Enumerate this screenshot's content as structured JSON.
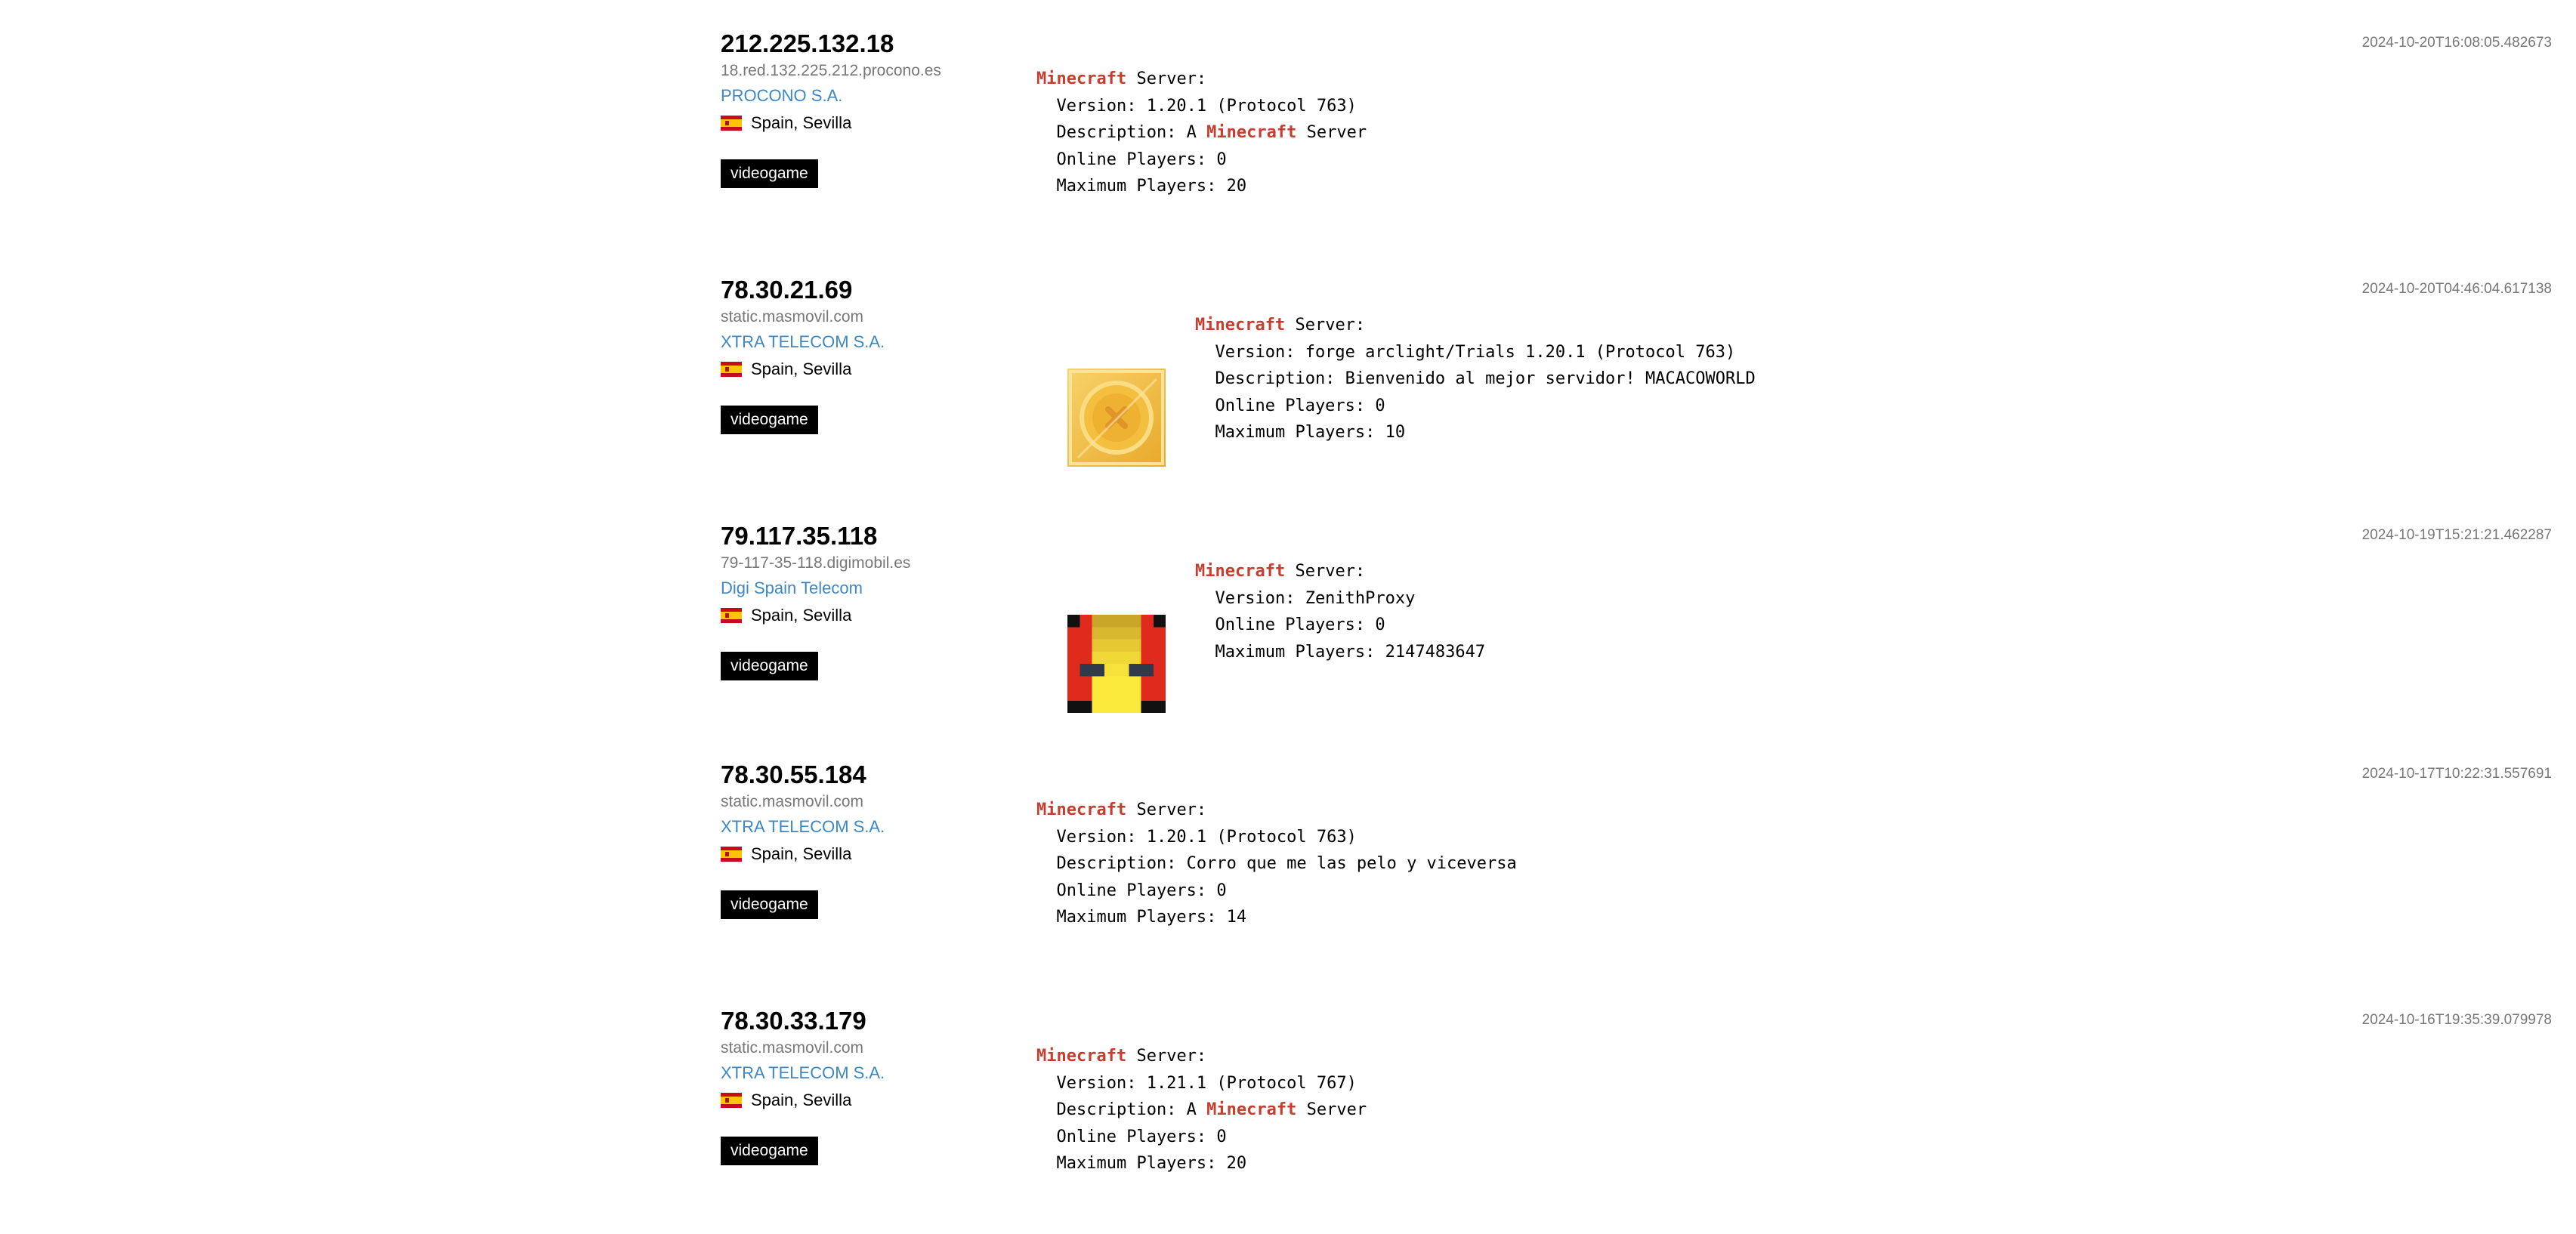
{
  "results": [
    {
      "ip": "212.225.132.18",
      "hostname": "18.red.132.225.212.procono.es",
      "org": "PROCONO S.A.",
      "location": "Spain, Sevilla",
      "tag": "videogame",
      "timestamp": "2024-10-20T16:08:05.482673",
      "banner": {
        "product": "Minecraft",
        "server_suffix": " Server:",
        "version_line": "  Version: 1.20.1 (Protocol 763)",
        "desc_prefix": "  Description: A ",
        "desc_highlight": "Minecraft",
        "desc_suffix": " Server",
        "online_line": "  Online Players: 0",
        "max_line": "  Maximum Players: 20"
      }
    },
    {
      "ip": "78.30.21.69",
      "hostname": "static.masmovil.com",
      "org": "XTRA TELECOM S.A.",
      "location": "Spain, Sevilla",
      "tag": "videogame",
      "timestamp": "2024-10-20T04:46:04.617138",
      "favicon_icon": "gold-coin-icon",
      "banner": {
        "product": "Minecraft",
        "server_suffix": " Server:",
        "version_line": "  Version: forge arclight/Trials 1.20.1 (Protocol 763)",
        "desc_line": "  Description: Bienvenido al mejor servidor! MACACOWORLD",
        "online_line": "  Online Players: 0",
        "max_line": "  Maximum Players: 10"
      }
    },
    {
      "ip": "79.117.35.118",
      "hostname": "79-117-35-118.digimobil.es",
      "org": "Digi Spain Telecom",
      "location": "Spain, Sevilla",
      "tag": "videogame",
      "timestamp": "2024-10-19T15:21:21.462287",
      "favicon_icon": "pixel-face-icon",
      "banner": {
        "product": "Minecraft",
        "server_suffix": " Server:",
        "version_line": "  Version: ZenithProxy",
        "online_line": "  Online Players: 0",
        "max_line": "  Maximum Players: 2147483647"
      }
    },
    {
      "ip": "78.30.55.184",
      "hostname": "static.masmovil.com",
      "org": "XTRA TELECOM S.A.",
      "location": "Spain, Sevilla",
      "tag": "videogame",
      "timestamp": "2024-10-17T10:22:31.557691",
      "banner": {
        "product": "Minecraft",
        "server_suffix": " Server:",
        "version_line": "  Version: 1.20.1 (Protocol 763)",
        "desc_line": "  Description: Corro que me las pelo y viceversa",
        "online_line": "  Online Players: 0",
        "max_line": "  Maximum Players: 14"
      }
    },
    {
      "ip": "78.30.33.179",
      "hostname": "static.masmovil.com",
      "org": "XTRA TELECOM S.A.",
      "location": "Spain, Sevilla",
      "tag": "videogame",
      "timestamp": "2024-10-16T19:35:39.079978",
      "banner": {
        "product": "Minecraft",
        "server_suffix": " Server:",
        "version_line": "  Version: 1.21.1 (Protocol 767)",
        "desc_prefix": "  Description: A ",
        "desc_highlight": "Minecraft",
        "desc_suffix": " Server",
        "online_line": "  Online Players: 0",
        "max_line": "  Maximum Players: 20"
      }
    }
  ],
  "colors": {
    "highlight": "#c63e2f",
    "org_link": "#3d87c4",
    "muted": "#777777",
    "tag_bg": "#000000"
  }
}
